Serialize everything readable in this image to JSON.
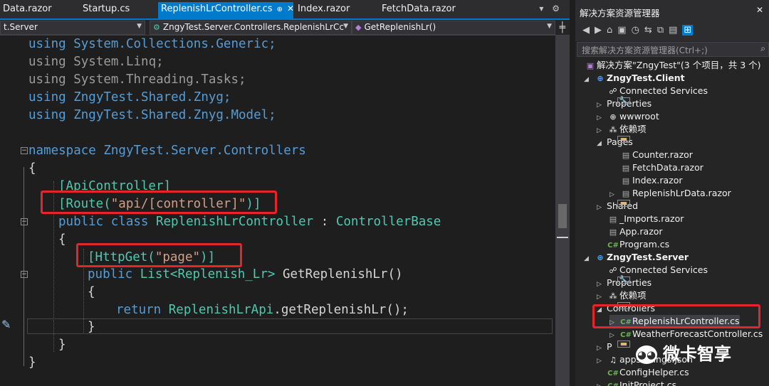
{
  "tabs": [
    {
      "label": "Data.razor"
    },
    {
      "label": "Startup.cs"
    },
    {
      "label": "ReplenishLrController.cs",
      "active": true
    },
    {
      "label": "Index.razor"
    },
    {
      "label": "FetchData.razor"
    }
  ],
  "tab_pin": "⊕",
  "tab_close": "✕",
  "tab_tools": "▾ ⚙",
  "nav": {
    "project": "t.Server",
    "class_path": "ZngyTest.Server.Controllers.ReplenishLrCc",
    "member": "GetReplenishLr()"
  },
  "code_lines": {
    "l1": "using System.Collections.Generic;",
    "l2": "using System.Linq;",
    "l3": "using System.Threading.Tasks;",
    "l4": "using ZngyTest.Shared.Znyg;",
    "l5": "using ZngyTest.Shared.Znyg.Model;",
    "l6": "namespace ZngyTest.Server.Controllers",
    "l7": "{",
    "l8": "[ApiController]",
    "l9_a": "[Route(",
    "l9_s": "\"api/[controller]\"",
    "l9_b": ")]",
    "l10_kw": "public class ",
    "l10_ty": "ReplenishLrController",
    "l10_p": " : ",
    "l10_b": "ControllerBase",
    "l11": "{",
    "l12_a": "[HttpGet(",
    "l12_s": "\"page\"",
    "l12_b": ")]",
    "l13_kw": "public ",
    "l13_ty": "List<Replenish_Lr>",
    "l13_m": " GetReplenishLr()",
    "l14": "{",
    "l15_kw": "return ",
    "l15_ty": "ReplenishLrApi",
    "l15_m": ".getReplenishLr();",
    "l16": "}",
    "l17": "}",
    "l18": "}"
  },
  "solution_explorer": {
    "title": "解决方案资源管理器",
    "close": "✕",
    "search_placeholder": "搜索解决方案资源管理器(Ctrl+;)",
    "tree": [
      {
        "label": "解决方案\"ZngyTest\"(3 个项目，共 3 个)",
        "icon": "solution"
      },
      {
        "label": "ZngyTest.Client",
        "icon": "project"
      },
      {
        "label": "Connected Services",
        "icon": "services"
      },
      {
        "label": "Properties",
        "icon": "properties"
      },
      {
        "label": "wwwroot",
        "icon": "globe"
      },
      {
        "label": "依赖项",
        "icon": "dependencies"
      },
      {
        "label": "Pages",
        "icon": "folder"
      },
      {
        "label": "Counter.razor",
        "icon": "razor"
      },
      {
        "label": "FetchData.razor",
        "icon": "razor"
      },
      {
        "label": "Index.razor",
        "icon": "razor"
      },
      {
        "label": "ReplenishLrData.razor",
        "icon": "razor"
      },
      {
        "label": "Shared",
        "icon": "folder"
      },
      {
        "label": "_Imports.razor",
        "icon": "razor"
      },
      {
        "label": "App.razor",
        "icon": "razor"
      },
      {
        "label": "Program.cs",
        "icon": "csharp"
      },
      {
        "label": "ZngyTest.Server",
        "icon": "project"
      },
      {
        "label": "Connected Services",
        "icon": "services"
      },
      {
        "label": "Properties",
        "icon": "properties"
      },
      {
        "label": "依赖项",
        "icon": "dependencies"
      },
      {
        "label": "Controllers",
        "icon": "folder"
      },
      {
        "label": "ReplenishLrController.cs",
        "icon": "csharp"
      },
      {
        "label": "WeatherForecastController.cs",
        "icon": "csharp"
      },
      {
        "label": "P",
        "icon": "folder"
      },
      {
        "label": "appsettings.json",
        "icon": "json"
      },
      {
        "label": "ConfigHelper.cs",
        "icon": "csharp"
      },
      {
        "label": "InitProject.cs",
        "icon": "csharp"
      }
    ]
  },
  "watermark": {
    "text": "微卡智享",
    "logo": "◕◕"
  },
  "colors": {
    "accent": "#007acc",
    "highlight_box": "#e8232a",
    "keyword": "#569cd6",
    "type": "#4ec9b0",
    "string": "#d69d85"
  }
}
